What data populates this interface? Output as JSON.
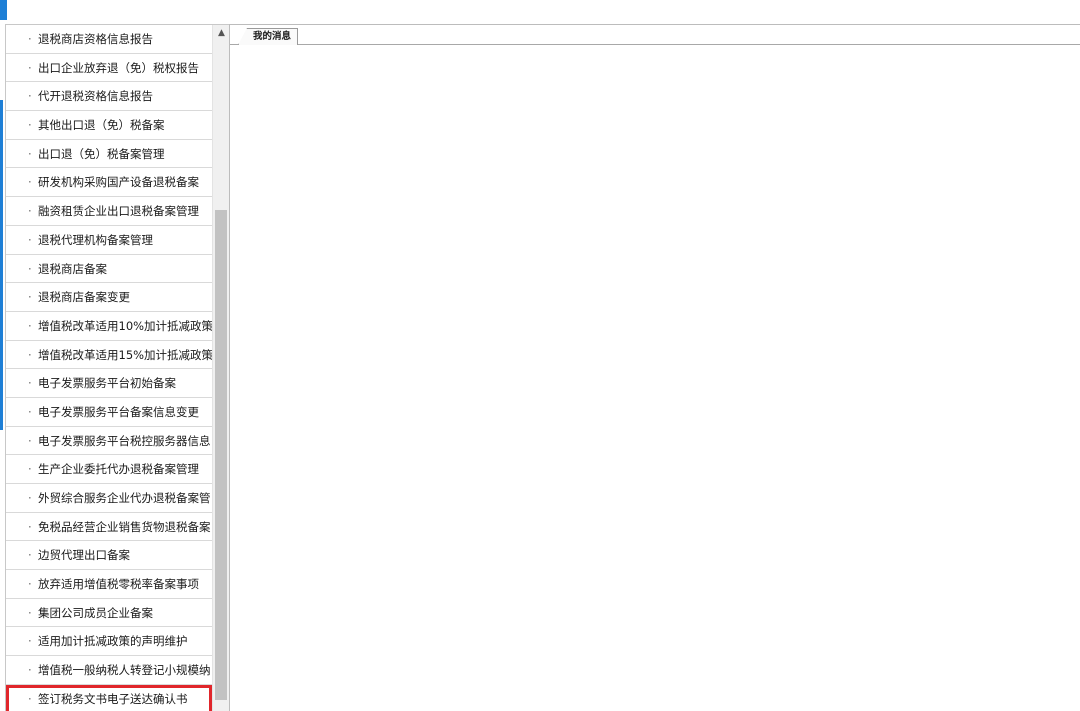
{
  "sidebar": {
    "bullet": "·",
    "items": [
      {
        "label": "退税商店资格信息报告"
      },
      {
        "label": "出口企业放弃退（免）税权报告"
      },
      {
        "label": "代开退税资格信息报告"
      },
      {
        "label": "其他出口退（免）税备案"
      },
      {
        "label": "出口退（免）税备案管理"
      },
      {
        "label": "研发机构采购国产设备退税备案"
      },
      {
        "label": "融资租赁企业出口退税备案管理"
      },
      {
        "label": "退税代理机构备案管理"
      },
      {
        "label": "退税商店备案"
      },
      {
        "label": "退税商店备案变更"
      },
      {
        "label": "增值税改革适用10%加计抵减政策"
      },
      {
        "label": "增值税改革适用15%加计抵减政策"
      },
      {
        "label": "电子发票服务平台初始备案"
      },
      {
        "label": "电子发票服务平台备案信息变更"
      },
      {
        "label": "电子发票服务平台税控服务器信息"
      },
      {
        "label": "生产企业委托代办退税备案管理"
      },
      {
        "label": "外贸综合服务企业代办退税备案管"
      },
      {
        "label": "免税品经营企业销售货物退税备案"
      },
      {
        "label": "边贸代理出口备案"
      },
      {
        "label": "放弃适用增值税零税率备案事项"
      },
      {
        "label": "集团公司成员企业备案"
      },
      {
        "label": "适用加计抵减政策的声明维护"
      },
      {
        "label": "增值税一般纳税人转登记小规模纳"
      },
      {
        "label": "签订税务文书电子送达确认书"
      }
    ],
    "highlighted_index": 23,
    "highlight_color": "#e0262b"
  },
  "tabs": [
    {
      "label": "我的消息"
    }
  ],
  "colors": {
    "accent": "#1e7fd6",
    "border": "#c8c8c8",
    "scroll_thumb": "#c2c2c2"
  },
  "icons": {
    "scroll_up": "chevron-up-icon"
  }
}
